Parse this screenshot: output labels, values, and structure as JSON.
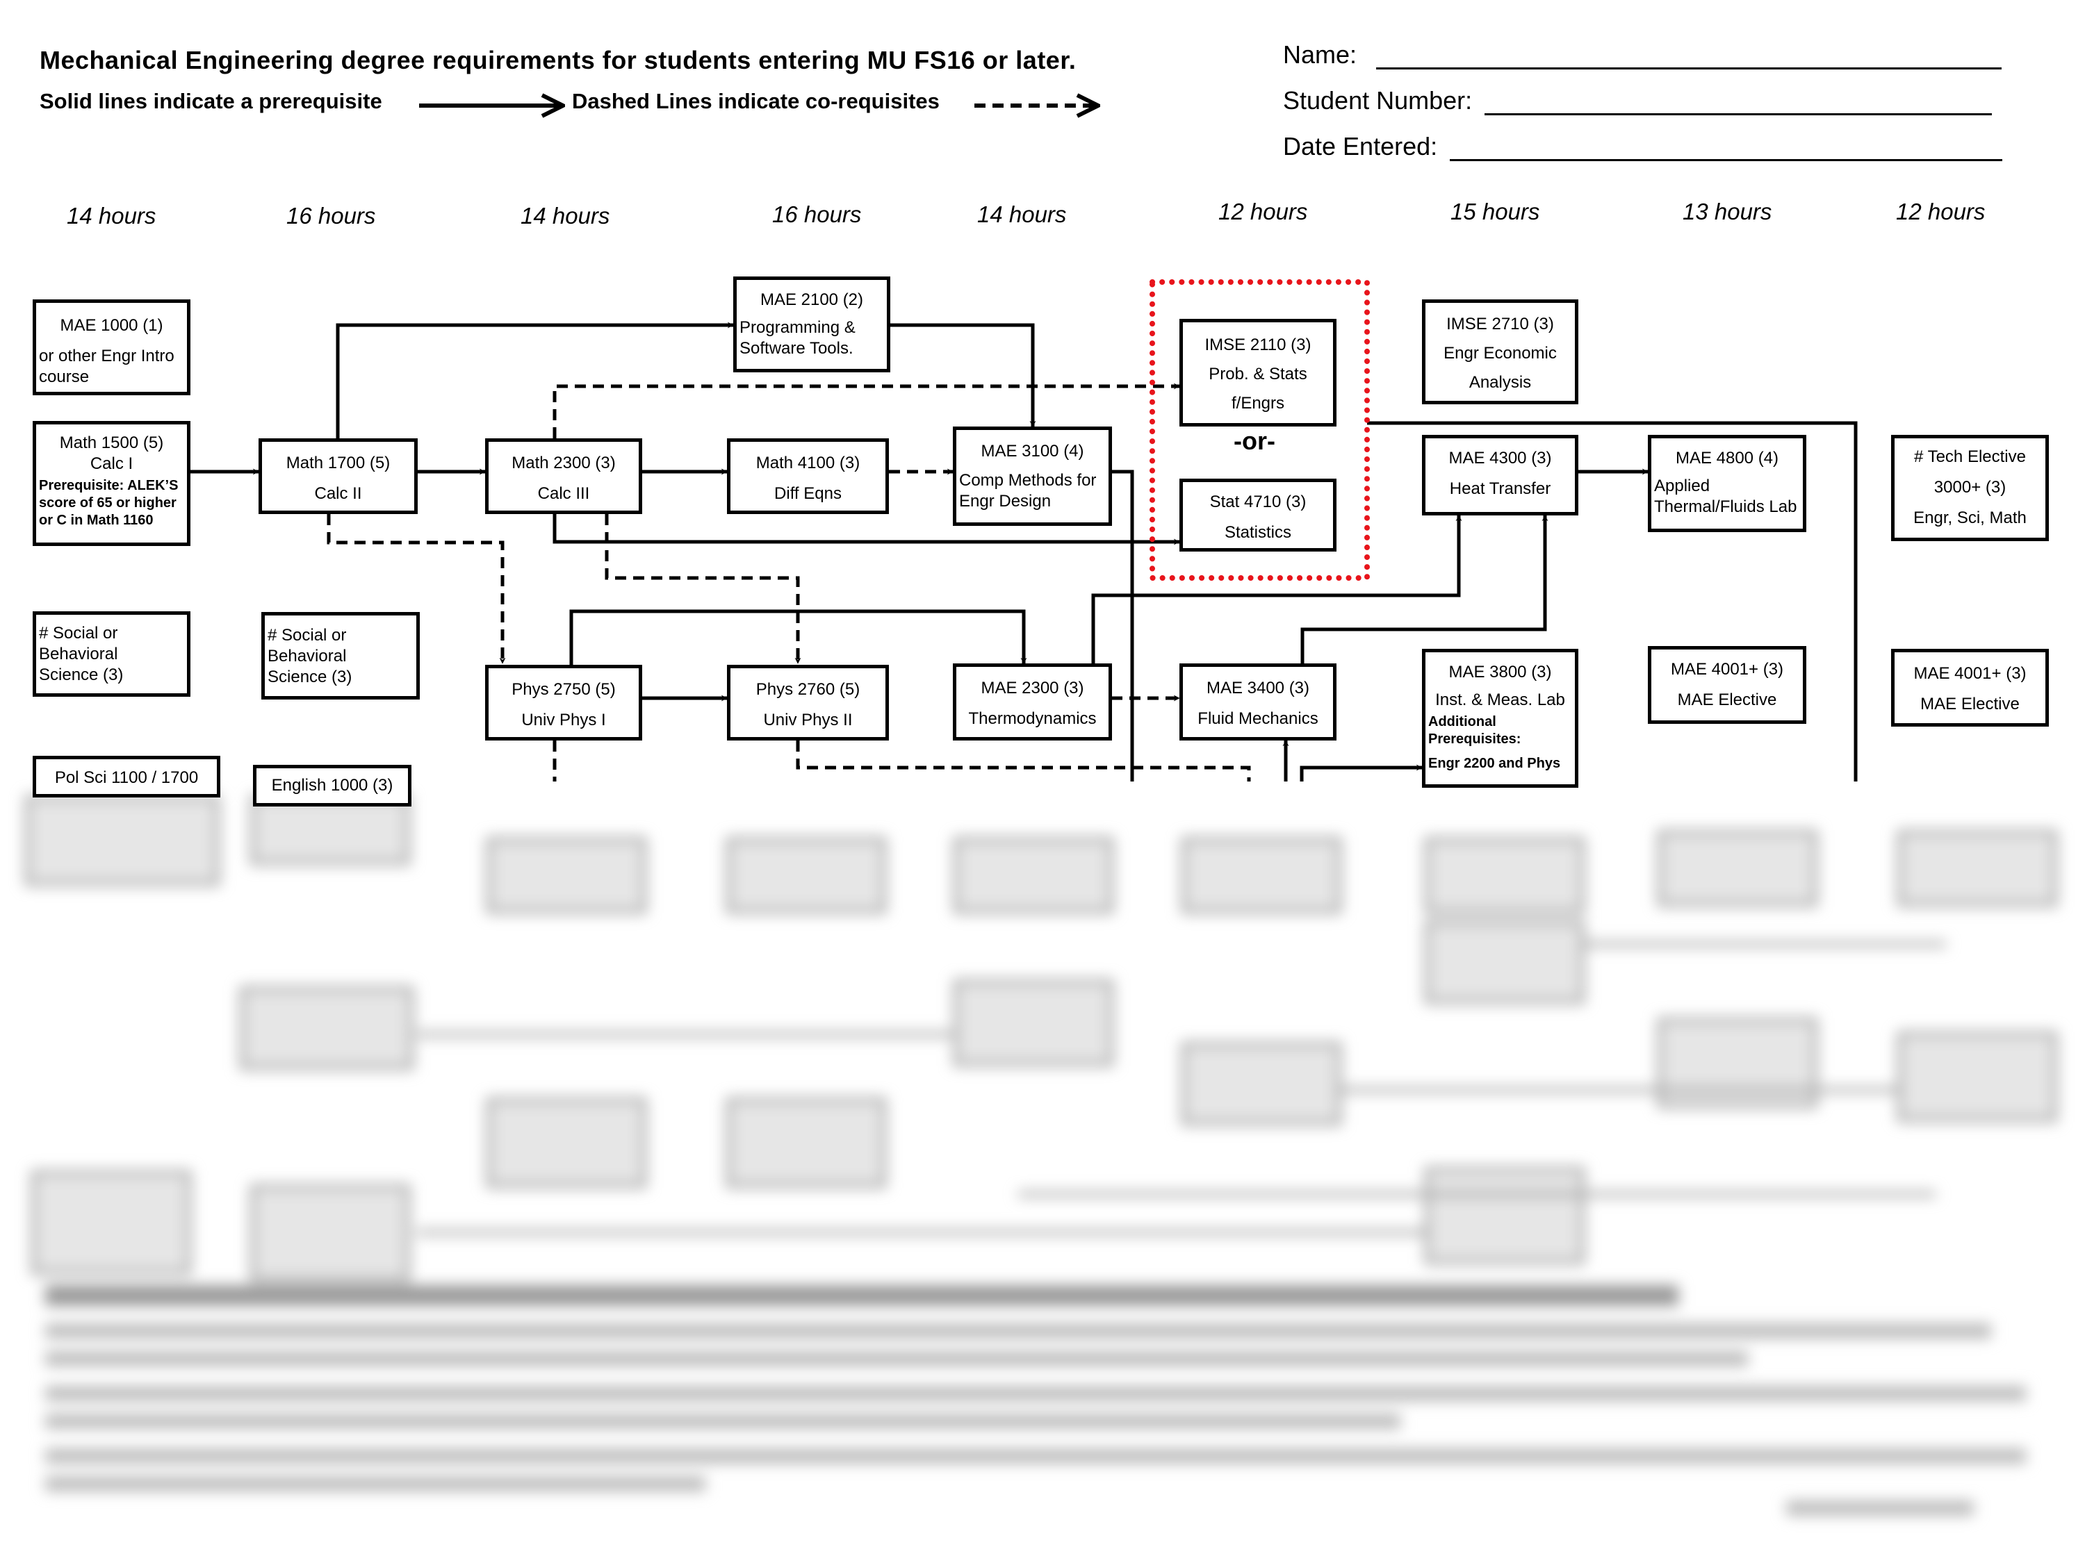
{
  "header": {
    "title": "Mechanical Engineering degree requirements for students entering MU FS16 or later.",
    "legend_solid": "Solid lines indicate a prerequisite",
    "legend_dashed": "Dashed Lines indicate co-requisites"
  },
  "form": {
    "name_label": "Name:",
    "student_number_label": "Student Number:",
    "date_entered_label": "Date Entered:",
    "name_value": "",
    "student_number_value": "",
    "date_entered_value": ""
  },
  "semester_hours": [
    "14 hours",
    "16 hours",
    "14 hours",
    "16 hours",
    "14 hours",
    "12 hours",
    "15 hours",
    "13 hours",
    "12 hours"
  ],
  "courses": {
    "mae1000": {
      "code": "MAE 1000 (1)",
      "desc1": "or other Engr Intro",
      "desc2": "course"
    },
    "math1500": {
      "code": "Math 1500 (5)",
      "name": "Calc I",
      "note": "Prerequisite: ALEK’S score of 65 or higher or C in Math 1160"
    },
    "social1": {
      "line1": "# Social or",
      "line2": "Behavioral",
      "line3": "Science (3)"
    },
    "polsci": {
      "code": "Pol Sci 1100 / 1700"
    },
    "math1700": {
      "code": "Math 1700 (5)",
      "name": "Calc II"
    },
    "social2": {
      "line1": "# Social or",
      "line2": "Behavioral",
      "line3": "Science (3)"
    },
    "english": {
      "code": "English 1000 (3)"
    },
    "math2300": {
      "code": "Math 2300 (3)",
      "name": "Calc III"
    },
    "phys2750": {
      "code": "Phys 2750 (5)",
      "name": "Univ Phys I"
    },
    "mae2100": {
      "code": "MAE 2100 (2)",
      "desc1": "Programming &",
      "desc2": "Software Tools."
    },
    "math4100": {
      "code": "Math 4100 (3)",
      "name": "Diff Eqns"
    },
    "phys2760": {
      "code": "Phys 2760 (5)",
      "name": "Univ Phys II"
    },
    "mae3100": {
      "code": "MAE 3100 (4)",
      "desc1": "Comp Methods for",
      "desc2": "Engr Design"
    },
    "mae2300": {
      "code": "MAE 2300 (3)",
      "name": "Thermodynamics"
    },
    "imse2110": {
      "code": "IMSE 2110 (3)",
      "name1": "Prob. & Stats",
      "name2": "f/Engrs"
    },
    "or_label": "-or-",
    "stat4710": {
      "code": "Stat 4710 (3)",
      "name": "Statistics"
    },
    "mae3400": {
      "code": "MAE 3400 (3)",
      "name": "Fluid Mechanics"
    },
    "imse2710": {
      "code": "IMSE 2710 (3)",
      "name1": "Engr Economic",
      "name2": "Analysis"
    },
    "mae4300": {
      "code": "MAE 4300 (3)",
      "name": "Heat Transfer"
    },
    "mae3800": {
      "code": "MAE 3800 (3)",
      "name": "Inst. & Meas. Lab",
      "note1": "Additional",
      "note2": "Prerequisites:",
      "note3": "Engr 2200 and Phys"
    },
    "mae4800": {
      "code": "MAE 4800 (4)",
      "desc1": "Applied",
      "desc2": "Thermal/Fluids Lab"
    },
    "mae4001a": {
      "code": "MAE 4001+ (3)",
      "name": "MAE Elective"
    },
    "tech_elective": {
      "line1": "# Tech Elective",
      "line2": "3000+ (3)",
      "line3": "Engr, Sci, Math"
    },
    "mae4001b": {
      "code": "MAE 4001+ (3)",
      "name": "MAE Elective"
    }
  },
  "colors": {
    "line": "#000000",
    "or_group_border": "#e8141b"
  }
}
